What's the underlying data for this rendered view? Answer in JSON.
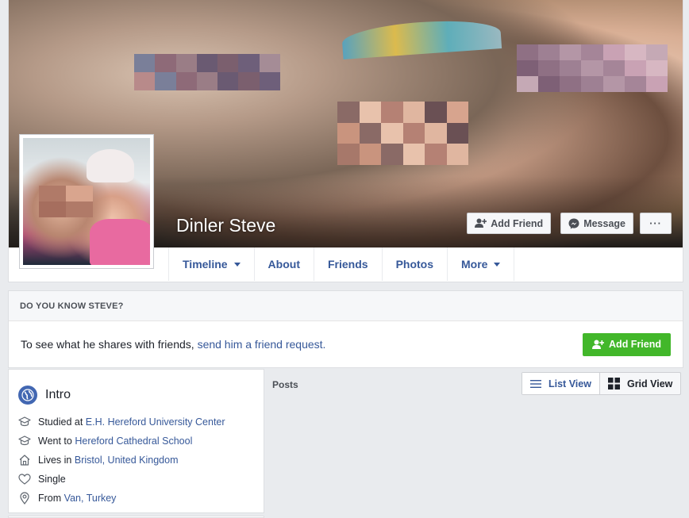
{
  "profile": {
    "name": "Dinler Steve"
  },
  "actions": {
    "add_friend_label": "Add Friend",
    "message_label": "Message",
    "more_label": "···"
  },
  "tabs": [
    {
      "label": "Timeline"
    },
    {
      "label": "About"
    },
    {
      "label": "Friends"
    },
    {
      "label": "Photos"
    },
    {
      "label": "More"
    }
  ],
  "know_card": {
    "header": "DO YOU KNOW STEVE?",
    "text": "To see what he shares with friends,",
    "link": "send him a friend request.",
    "button_label": "Add Friend"
  },
  "intro": {
    "title": "Intro",
    "items": [
      {
        "icon": "graduation-cap-icon",
        "prefix": "Studied at",
        "link": "E.H. Hereford University Center"
      },
      {
        "icon": "graduation-cap-icon",
        "prefix": "Went to",
        "link": "Hereford Cathedral School"
      },
      {
        "icon": "home-icon",
        "prefix": "Lives in",
        "link": "Bristol, United Kingdom"
      },
      {
        "icon": "heart-icon",
        "prefix": "Single",
        "link": ""
      },
      {
        "icon": "location-pin-icon",
        "prefix": "From",
        "link": "Van, Turkey"
      }
    ]
  },
  "posts": {
    "label": "Posts",
    "list_view_label": "List View",
    "grid_view_label": "Grid View"
  },
  "colors": {
    "page_background": "#e9ebee",
    "link": "#365899",
    "green_button": "#42b72a",
    "brand_blue": "#4267b2"
  }
}
